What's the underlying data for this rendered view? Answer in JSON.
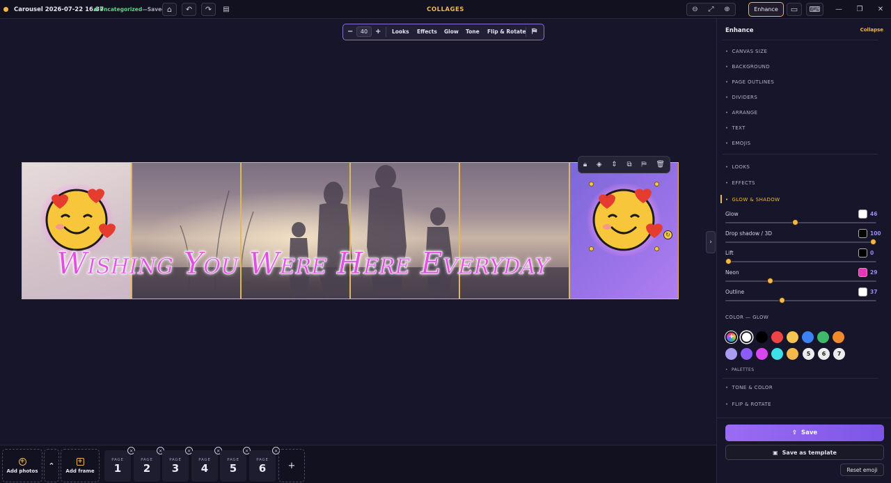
{
  "topbar": {
    "doc_title": "Carousel 2026-07-22 16.37",
    "status_category": "Uncategorized",
    "status_sep": " — ",
    "status_saved": "Saved",
    "center_title": "COLLAGES",
    "enhance_label": "Enhance",
    "icons": [
      "home-icon",
      "undo-icon",
      "redo-icon",
      "document-icon",
      "zoom-out-icon",
      "fit-icon",
      "zoom-in-icon",
      "ruler-icon",
      "keyboard-icon",
      "minimize-icon",
      "restore-icon",
      "close-icon"
    ]
  },
  "float_toolbar": {
    "minus": "−",
    "size": "40",
    "plus": "+",
    "items": [
      "Looks",
      "Effects",
      "Glow",
      "Tone",
      "Flip & Rotate"
    ]
  },
  "canvas": {
    "text": "Wishing You Were Here Everyday"
  },
  "bottombar": {
    "add_photos": "Add photos",
    "add_frame": "Add frame",
    "page_label": "PAGE",
    "pages": [
      "1",
      "2",
      "3",
      "4",
      "5",
      "6"
    ],
    "add_page": "+"
  },
  "panel": {
    "title": "Enhance",
    "collapse": "Collapse",
    "sections_top": [
      "CANVAS SIZE",
      "BACKGROUND",
      "PAGE OUTLINES",
      "DIVIDERS",
      "ARRANGE",
      "TEXT",
      "EMOJIS"
    ],
    "sections_mid": [
      "LOOKS",
      "EFFECTS"
    ],
    "active_section": "GLOW & SHADOW",
    "sliders": [
      {
        "label": "Glow",
        "value": "46",
        "color": "#ffffff",
        "level": 0.46
      },
      {
        "label": "Drop shadow / 3D",
        "value": "100",
        "color": "#000000",
        "level": 1.0
      },
      {
        "label": "Lift",
        "value": "0",
        "color": "#000000",
        "level": 0.0
      },
      {
        "label": "Neon",
        "value": "29",
        "color": "#e535b8",
        "level": 0.29
      },
      {
        "label": "Outline",
        "value": "37",
        "color": "#ffffff",
        "level": 0.37
      }
    ],
    "color_heading": "COLOR — GLOW",
    "colors_row1": [
      "#ffffff",
      "#000000",
      "#ef4444",
      "#f5c451",
      "#3b82f6",
      "#3fba6a",
      "#f28a2b"
    ],
    "colors_row2": [
      "#a99bf0",
      "#8b5cf6",
      "#d946ef",
      "#3de0e8",
      "#f5b84b"
    ],
    "color_nums": [
      "5",
      "6",
      "7"
    ],
    "palettes": "PALETTES",
    "sections_bottom": [
      "TONE & COLOR",
      "FLIP & ROTATE"
    ],
    "save": "Save",
    "save_template": "Save as template",
    "reset_emoji": "Reset emoji"
  }
}
